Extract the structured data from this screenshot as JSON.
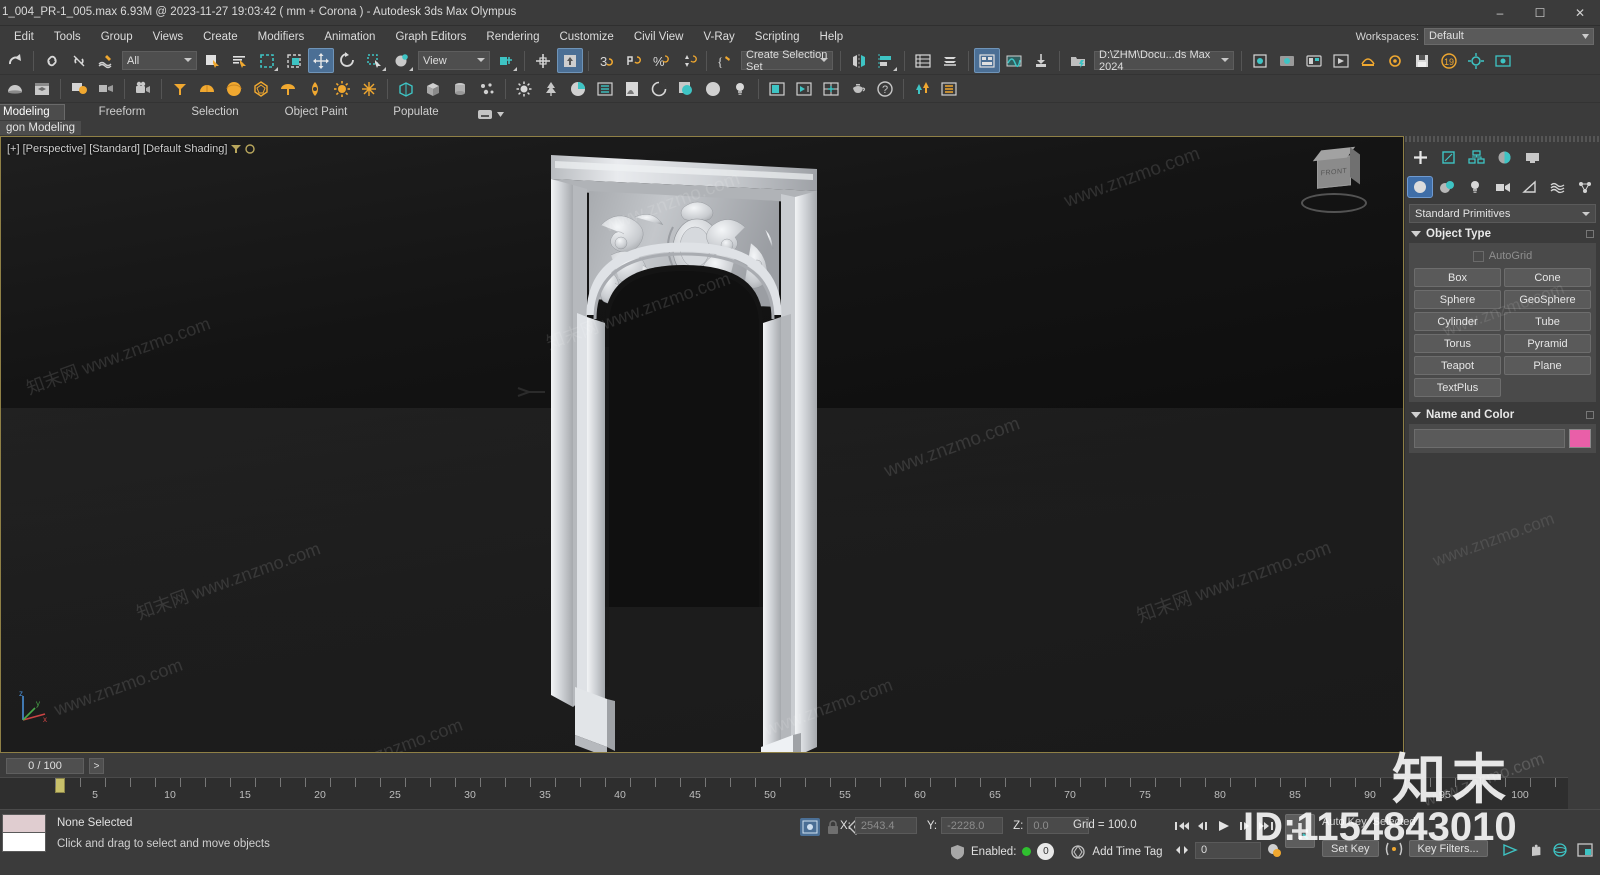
{
  "titlebar": {
    "title": "1_004_PR-1_005.max  6.93M @ 2023-11-27 19:03:42  ( mm + Corona ) - Autodesk 3ds Max Olympus",
    "minimize": "–",
    "maximize": "☐",
    "close": "✕"
  },
  "menubar": {
    "items": [
      {
        "label": "Edit"
      },
      {
        "label": "Tools"
      },
      {
        "label": "Group"
      },
      {
        "label": "Views"
      },
      {
        "label": "Create"
      },
      {
        "label": "Modifiers"
      },
      {
        "label": "Animation"
      },
      {
        "label": "Graph Editors"
      },
      {
        "label": "Rendering"
      },
      {
        "label": "Customize"
      },
      {
        "label": "Civil View"
      },
      {
        "label": "V-Ray"
      },
      {
        "label": "Scripting"
      },
      {
        "label": "Help"
      }
    ],
    "workspaces_label": "Workspaces:",
    "workspaces_value": "Default"
  },
  "toolbar": {
    "selection_filter": "All",
    "reference_coord": "View",
    "named_selection_set": "Create Selection Set",
    "project_folder": "D:\\ZHM\\Docu...ds Max 2024",
    "row1_icons": [
      "redo-icon",
      "select-and-link-icon",
      "unlink-selection-icon",
      "bind-to-space-warp-icon",
      "select-object-icon",
      "select-by-name-icon",
      "rectangular-selection-region-icon",
      "window-crossing-icon",
      "select-and-move-icon",
      "select-and-rotate-icon",
      "select-and-scale-icon",
      "select-and-place-icon",
      "use-center-flyout-icon",
      "select-and-manipulate-icon",
      "snaps-toggle-icon",
      "angle-snap-toggle-icon",
      "percent-snap-toggle-icon",
      "spinner-snap-toggle-icon",
      "edit-named-selection-icon",
      "mirror-icon",
      "align-icon",
      "layer-explorer-icon",
      "scene-explorer-icon",
      "toggle-ribbon-icon",
      "curve-editor-icon",
      "schematic-view-icon"
    ],
    "row2_icons": [
      "material-editor-icon",
      "render-setup-icon",
      "rendered-frame-window-icon",
      "render-production-icon",
      "render-iterative-icon",
      "cone-icon",
      "hemisphere-icon",
      "sphere-icon",
      "geosphere-icon",
      "light-icon",
      "omni-light-icon",
      "sun-icon",
      "star-icon",
      "box-icon",
      "target-light-icon",
      "tree-icon",
      "corona-icon",
      "list-icon",
      "scatter-icon",
      "corona-proxy-icon",
      "bitmap-icon",
      "material-icon",
      "light-bulb-icon",
      "frame-buffer-icon",
      "render-preview-icon",
      "viewport-layout-icon",
      "teapot-icon",
      "help-icon",
      "forest-pack-icon",
      "list-panel-icon"
    ]
  },
  "ribbon": {
    "tabs": [
      {
        "label": "Modeling",
        "selected": true
      },
      {
        "label": "Freeform",
        "selected": false
      },
      {
        "label": "Selection",
        "selected": false
      },
      {
        "label": "Object Paint",
        "selected": false
      },
      {
        "label": "Populate",
        "selected": false
      }
    ],
    "subtab": "gon Modeling"
  },
  "viewport": {
    "label": "[+] [Perspective] [Standard] [Default Shading]",
    "viewcube_face": "FRONT",
    "axis_x": "x",
    "axis_y": "y",
    "axis_z": "z"
  },
  "command_panel": {
    "tabs_row1": [
      {
        "name": "create-tab",
        "icon": "plus-icon",
        "selected": true
      },
      {
        "name": "modify-tab",
        "icon": "modify-icon",
        "selected": false
      },
      {
        "name": "hierarchy-tab",
        "icon": "hierarchy-icon",
        "selected": false
      },
      {
        "name": "motion-tab",
        "icon": "motion-icon",
        "selected": false
      },
      {
        "name": "display-tab",
        "icon": "display-icon",
        "selected": false
      }
    ],
    "tabs_row2": [
      {
        "name": "geometry-tab",
        "icon": "sphere-icon",
        "selected": true
      },
      {
        "name": "shapes-tab",
        "icon": "shapes-icon",
        "selected": false
      },
      {
        "name": "lights-tab",
        "icon": "light-icon",
        "selected": false
      },
      {
        "name": "cameras-tab",
        "icon": "camera-icon",
        "selected": false
      },
      {
        "name": "helpers-tab",
        "icon": "helpers-icon",
        "selected": false
      },
      {
        "name": "space-warps-tab",
        "icon": "space-warps-icon",
        "selected": false
      },
      {
        "name": "systems-tab",
        "icon": "systems-icon",
        "selected": false
      }
    ],
    "category": "Standard Primitives",
    "object_type": {
      "title": "Object Type",
      "autogrid": "AutoGrid",
      "buttons": [
        "Box",
        "Cone",
        "Sphere",
        "GeoSphere",
        "Cylinder",
        "Tube",
        "Torus",
        "Pyramid",
        "Teapot",
        "Plane",
        "TextPlus"
      ]
    },
    "name_and_color": {
      "title": "Name and Color",
      "name_value": "",
      "color": "#e95fa8"
    }
  },
  "timeline": {
    "frame_display": "0 / 100",
    "next_frame": ">",
    "ticks": [
      5,
      10,
      15,
      20,
      25,
      30,
      35,
      40,
      45,
      50,
      55,
      60,
      65,
      70,
      75,
      80,
      85,
      90,
      95,
      100
    ],
    "current_frame": 0,
    "total_frames": 100
  },
  "statusbar": {
    "selection_status": "None Selected",
    "prompt": "Click and drag to select and move objects",
    "coord_x_label": "X:",
    "coord_x_value": "2543.4",
    "coord_y_label": "Y:",
    "coord_y_value": "-2228.0",
    "coord_z_label": "Z:",
    "coord_z_value": "0.0",
    "grid": "Grid = 100.0",
    "enabled_label": "Enabled:",
    "enabled_count": "0",
    "add_time_tag": "Add Time Tag",
    "auto_key": "Auto Key",
    "selected": "Selected",
    "set_key": "Set Key",
    "key_filters": "Key Filters...",
    "spinner_value": "0",
    "anim_buttons": [
      "go-to-start-icon",
      "previous-frame-icon",
      "play-animation-icon",
      "next-frame-icon",
      "go-to-end-icon"
    ],
    "nav_icons": [
      "zoom-icon",
      "pan-icon",
      "orbit-icon",
      "maximize-viewport-icon"
    ]
  },
  "watermarks": {
    "site": "www.znzmo.com",
    "cn_site": "知末网 www.znzmo.com",
    "brand": "知末",
    "id": "ID:1154843010"
  },
  "colors": {
    "app_bg": "#3b3b3b",
    "panel_bg": "#4a4a4a",
    "accent_blue": "#3f6ea8",
    "viewport_border": "#8f8046",
    "teal_icon": "#3ec4c4",
    "gold_icon": "#f0a830",
    "name_color": "#e95fa8"
  }
}
